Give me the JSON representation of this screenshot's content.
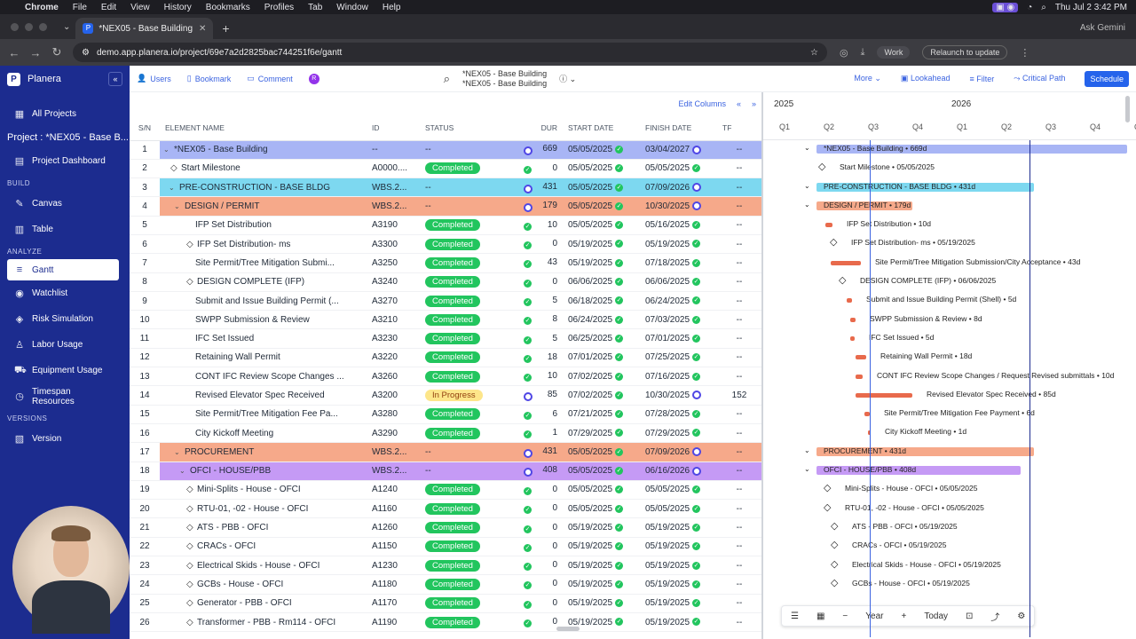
{
  "mac": {
    "app": "Chrome",
    "menu": [
      "File",
      "Edit",
      "View",
      "History",
      "Bookmarks",
      "Profiles",
      "Tab",
      "Window",
      "Help"
    ],
    "clock": "Thu Jul 2  3:42 PM"
  },
  "browser": {
    "tab_title": "*NEX05 - Base Building",
    "url": "demo.app.planera.io/project/69e7a2d2825bac744251f6e/gantt",
    "gemini": "Ask Gemini",
    "work": "Work",
    "relaunch": "Relaunch to update"
  },
  "sidebar": {
    "brand": "Planera",
    "all_projects": "All Projects",
    "project": "Project : *NEX05 - Base B...",
    "dashboard": "Project Dashboard",
    "build_label": "BUILD",
    "canvas": "Canvas",
    "table": "Table",
    "analyze_label": "ANALYZE",
    "gantt": "Gantt",
    "watchlist": "Watchlist",
    "risk": "Risk Simulation",
    "labor": "Labor Usage",
    "equipment": "Equipment Usage",
    "timespan": "Timespan Resources",
    "versions_label": "VERSIONS",
    "version": "Version"
  },
  "toolbar": {
    "users": "Users",
    "bookmark": "Bookmark",
    "comment": "Comment",
    "avatar": "R",
    "title1": "*NEX05 - Base Building",
    "title2": "*NEX05 - Base Building",
    "more": "More",
    "lookahead": "Lookahead",
    "filter": "Filter",
    "critical": "Critical Path",
    "schedule": "Schedule"
  },
  "grid": {
    "edit_columns": "Edit Columns",
    "headers": [
      "S/N",
      "ELEMENT NAME",
      "ID",
      "STATUS",
      "DUR",
      "START DATE",
      "FINISH DATE",
      "TF"
    ]
  },
  "rows": [
    {
      "sn": "1",
      "name": "*NEX05 - Base Building",
      "id": "--",
      "status": "--",
      "dur": "669",
      "start": "05/05/2025",
      "finish": "03/04/2027",
      "tf": "--"
    },
    {
      "sn": "2",
      "name": "Start Milestone",
      "id": "A0000....",
      "status": "Completed",
      "dur": "0",
      "start": "05/05/2025",
      "finish": "05/05/2025",
      "tf": "--"
    },
    {
      "sn": "3",
      "name": "PRE-CONSTRUCTION - BASE BLDG",
      "id": "WBS.2...",
      "status": "--",
      "dur": "431",
      "start": "05/05/2025",
      "finish": "07/09/2026",
      "tf": "--"
    },
    {
      "sn": "4",
      "name": "DESIGN / PERMIT",
      "id": "WBS.2...",
      "status": "--",
      "dur": "179",
      "start": "05/05/2025",
      "finish": "10/30/2025",
      "tf": "--"
    },
    {
      "sn": "5",
      "name": "IFP Set Distribution",
      "id": "A3190",
      "status": "Completed",
      "dur": "10",
      "start": "05/05/2025",
      "finish": "05/16/2025",
      "tf": "--"
    },
    {
      "sn": "6",
      "name": "IFP Set Distribution- ms",
      "id": "A3300",
      "status": "Completed",
      "dur": "0",
      "start": "05/19/2025",
      "finish": "05/19/2025",
      "tf": "--"
    },
    {
      "sn": "7",
      "name": "Site Permit/Tree Mitigation Submi...",
      "id": "A3250",
      "status": "Completed",
      "dur": "43",
      "start": "05/19/2025",
      "finish": "07/18/2025",
      "tf": "--"
    },
    {
      "sn": "8",
      "name": "DESIGN COMPLETE (IFP)",
      "id": "A3240",
      "status": "Completed",
      "dur": "0",
      "start": "06/06/2025",
      "finish": "06/06/2025",
      "tf": "--"
    },
    {
      "sn": "9",
      "name": "Submit and Issue Building Permit (...",
      "id": "A3270",
      "status": "Completed",
      "dur": "5",
      "start": "06/18/2025",
      "finish": "06/24/2025",
      "tf": "--"
    },
    {
      "sn": "10",
      "name": "SWPP Submission & Review",
      "id": "A3210",
      "status": "Completed",
      "dur": "8",
      "start": "06/24/2025",
      "finish": "07/03/2025",
      "tf": "--"
    },
    {
      "sn": "11",
      "name": "IFC Set Issued",
      "id": "A3230",
      "status": "Completed",
      "dur": "5",
      "start": "06/25/2025",
      "finish": "07/01/2025",
      "tf": "--"
    },
    {
      "sn": "12",
      "name": "Retaining Wall Permit",
      "id": "A3220",
      "status": "Completed",
      "dur": "18",
      "start": "07/01/2025",
      "finish": "07/25/2025",
      "tf": "--"
    },
    {
      "sn": "13",
      "name": "CONT IFC Review Scope Changes ...",
      "id": "A3260",
      "status": "Completed",
      "dur": "10",
      "start": "07/02/2025",
      "finish": "07/16/2025",
      "tf": "--"
    },
    {
      "sn": "14",
      "name": "Revised Elevator Spec Received",
      "id": "A3200",
      "status": "In Progress",
      "dur": "85",
      "start": "07/02/2025",
      "finish": "10/30/2025",
      "tf": "152"
    },
    {
      "sn": "15",
      "name": "Site Permit/Tree Mitigation Fee Pa...",
      "id": "A3280",
      "status": "Completed",
      "dur": "6",
      "start": "07/21/2025",
      "finish": "07/28/2025",
      "tf": "--"
    },
    {
      "sn": "16",
      "name": "City Kickoff Meeting",
      "id": "A3290",
      "status": "Completed",
      "dur": "1",
      "start": "07/29/2025",
      "finish": "07/29/2025",
      "tf": "--"
    },
    {
      "sn": "17",
      "name": "PROCUREMENT",
      "id": "WBS.2...",
      "status": "--",
      "dur": "431",
      "start": "05/05/2025",
      "finish": "07/09/2026",
      "tf": "--"
    },
    {
      "sn": "18",
      "name": "OFCI - HOUSE/PBB",
      "id": "WBS.2...",
      "status": "--",
      "dur": "408",
      "start": "05/05/2025",
      "finish": "06/16/2026",
      "tf": "--"
    },
    {
      "sn": "19",
      "name": "Mini-Splits - House - OFCI",
      "id": "A1240",
      "status": "Completed",
      "dur": "0",
      "start": "05/05/2025",
      "finish": "05/05/2025",
      "tf": "--"
    },
    {
      "sn": "20",
      "name": "RTU-01, -02 - House - OFCI",
      "id": "A1160",
      "status": "Completed",
      "dur": "0",
      "start": "05/05/2025",
      "finish": "05/05/2025",
      "tf": "--"
    },
    {
      "sn": "21",
      "name": "ATS - PBB - OFCI",
      "id": "A1260",
      "status": "Completed",
      "dur": "0",
      "start": "05/19/2025",
      "finish": "05/19/2025",
      "tf": "--"
    },
    {
      "sn": "22",
      "name": "CRACs - OFCI",
      "id": "A1150",
      "status": "Completed",
      "dur": "0",
      "start": "05/19/2025",
      "finish": "05/19/2025",
      "tf": "--"
    },
    {
      "sn": "23",
      "name": "Electrical Skids - House - OFCI",
      "id": "A1230",
      "status": "Completed",
      "dur": "0",
      "start": "05/19/2025",
      "finish": "05/19/2025",
      "tf": "--"
    },
    {
      "sn": "24",
      "name": "GCBs - House - OFCI",
      "id": "A1180",
      "status": "Completed",
      "dur": "0",
      "start": "05/19/2025",
      "finish": "05/19/2025",
      "tf": "--"
    },
    {
      "sn": "25",
      "name": "Generator - PBB - OFCI",
      "id": "A1170",
      "status": "Completed",
      "dur": "0",
      "start": "05/19/2025",
      "finish": "05/19/2025",
      "tf": "--"
    },
    {
      "sn": "26",
      "name": "Transformer - PBB - Rm114 - OFCI",
      "id": "A1190",
      "status": "Completed",
      "dur": "0",
      "start": "05/19/2025",
      "finish": "05/19/2025",
      "tf": "--"
    }
  ],
  "gantt": {
    "years": [
      "2025",
      "2026"
    ],
    "quarters": [
      "Q1",
      "Q2",
      "Q3",
      "Q4",
      "Q1",
      "Q2",
      "Q3",
      "Q4",
      "Q"
    ],
    "labels": [
      "*NEX05 - Base Building • 669d",
      "Start Milestone • 05/05/2025",
      "PRE-CONSTRUCTION - BASE BLDG • 431d",
      "DESIGN / PERMIT • 179d",
      "IFP Set Distribution • 10d",
      "IFP Set Distribution- ms • 05/19/2025",
      "Site Permit/Tree Mitigation Submission/City Acceptance • 43d",
      "DESIGN COMPLETE (IFP) • 06/06/2025",
      "Submit and Issue Building Permit (Shell) • 5d",
      "SWPP Submission & Review • 8d",
      "IFC Set Issued • 5d",
      "Retaining Wall Permit • 18d",
      "CONT IFC Review Scope Changes / Request Revised submittals • 10d",
      "Revised Elevator Spec Received • 85d",
      "Site Permit/Tree Mitigation Fee Payment • 6d",
      "City Kickoff Meeting • 1d",
      "PROCUREMENT • 431d",
      "OFCI - HOUSE/PBB • 408d",
      "Mini-Splits - House - OFCI • 05/05/2025",
      "RTU-01, -02 - House - OFCI • 05/05/2025",
      "ATS - PBB - OFCI • 05/19/2025",
      "CRACs - OFCI • 05/19/2025",
      "Electrical Skids - House - OFCI • 05/19/2025",
      "GCBs - House - OFCI • 05/19/2025"
    ],
    "tools": {
      "zoom": "Year",
      "today": "Today"
    }
  },
  "colors": {
    "sidebar": "#1c2c8f",
    "root": "#a8b5f5",
    "precon": "#7dd8f0",
    "design": "#f6a98a",
    "procurement": "#f6a98a",
    "ofci": "#c59af5",
    "bar": "#e86a4c"
  }
}
